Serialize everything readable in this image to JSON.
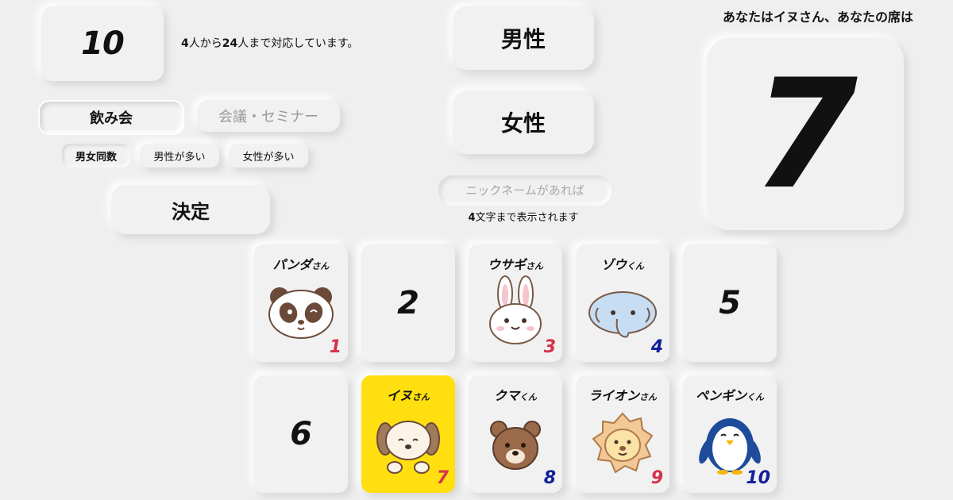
{
  "settings": {
    "count": "10",
    "range": {
      "min": "4",
      "mid": "人から",
      "max": "24",
      "tail": "人まで対応しています。"
    },
    "modes": [
      "飲み会",
      "会議・セミナー"
    ],
    "ratios": [
      "男女同数",
      "男性が多い",
      "女性が多い"
    ],
    "decide_label": "決定"
  },
  "gender": {
    "male_label": "男性",
    "female_label": "女性"
  },
  "nickname": {
    "placeholder": "ニックネームがあれば",
    "hint_num": "4",
    "hint_text": "文字まで表示されます"
  },
  "result": {
    "message": "あなたはイヌさん、あなたの席は",
    "seat_number": "7"
  },
  "seats": [
    {
      "name": "パンダ",
      "suffix": "さん",
      "number": "1",
      "color": "#d6304b",
      "icon": "panda-icon"
    },
    {
      "name": "",
      "suffix": "",
      "number": "2",
      "color": "#111111",
      "icon": ""
    },
    {
      "name": "ウサギ",
      "suffix": "さん",
      "number": "3",
      "color": "#d6304b",
      "icon": "rabbit-icon"
    },
    {
      "name": "ゾウ",
      "suffix": "くん",
      "number": "4",
      "color": "#111f9c",
      "icon": "elephant-icon"
    },
    {
      "name": "",
      "suffix": "",
      "number": "5",
      "color": "#111111",
      "icon": ""
    },
    {
      "name": "",
      "suffix": "",
      "number": "6",
      "color": "#111111",
      "icon": ""
    },
    {
      "name": "イヌ",
      "suffix": "さん",
      "number": "7",
      "color": "#d6304b",
      "icon": "dog-icon",
      "selected": true
    },
    {
      "name": "クマ",
      "suffix": "くん",
      "number": "8",
      "color": "#111f9c",
      "icon": "bear-icon"
    },
    {
      "name": "ライオン",
      "suffix": "さん",
      "number": "9",
      "color": "#d6304b",
      "icon": "lion-icon"
    },
    {
      "name": "ペンギン",
      "suffix": "くん",
      "number": "10",
      "color": "#111f9c",
      "icon": "penguin-icon"
    }
  ],
  "colors": {
    "background": "#efefef",
    "highlight": "#ffdf0f",
    "female_number": "#d6304b",
    "male_number": "#111f9c"
  }
}
